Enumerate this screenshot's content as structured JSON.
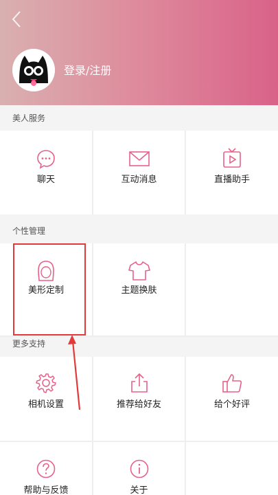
{
  "colors": {
    "accent": "#e7608a",
    "highlight": "#e23a3a",
    "header_start": "#d9b0b0",
    "header_end": "#d96289"
  },
  "header": {
    "back_icon": "chevron-left-icon",
    "login_label": "登录/注册"
  },
  "sections": [
    {
      "title": "美人服务",
      "items": [
        {
          "label": "聊天",
          "icon": "chat-icon"
        },
        {
          "label": "互动消息",
          "icon": "mail-icon"
        },
        {
          "label": "直播助手",
          "icon": "tv-icon"
        }
      ]
    },
    {
      "title": "个性管理",
      "items": [
        {
          "label": "美形定制",
          "icon": "face-outline-icon"
        },
        {
          "label": "主题换肤",
          "icon": "tshirt-icon"
        }
      ]
    },
    {
      "title": "更多支持",
      "items": [
        {
          "label": "相机设置",
          "icon": "gear-icon"
        },
        {
          "label": "推荐给好友",
          "icon": "share-icon"
        },
        {
          "label": "给个好评",
          "icon": "thumbs-up-icon"
        },
        {
          "label": "帮助与反馈",
          "icon": "help-icon"
        },
        {
          "label": "关于",
          "icon": "info-icon"
        }
      ]
    }
  ]
}
